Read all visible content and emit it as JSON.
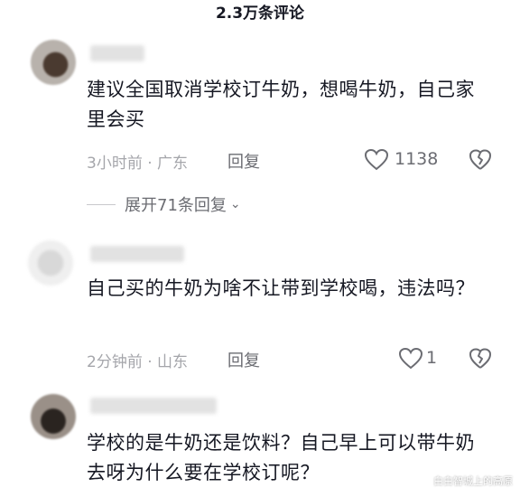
{
  "header": {
    "title": "2.3万条评论"
  },
  "comments": [
    {
      "text": "建议全国取消学校订牛奶，想喝牛奶，自己家里会买",
      "time_location": "3小时前 · 广东",
      "reply_label": "回复",
      "likes": "1138",
      "expand_label": "展开71条回复"
    },
    {
      "text": "自己买的牛奶为啥不让带到学校喝，违法吗？",
      "time_location": "2分钟前 · 山东",
      "reply_label": "回复",
      "likes": "1"
    },
    {
      "text": "学校的是牛奶还是饮料？自己早上可以带牛奶去呀为什么要在学校订呢？"
    }
  ],
  "watermark": "白白智城上的高原",
  "icons": {
    "like": "heart-outline-icon",
    "dislike": "broken-heart-icon",
    "expand": "chevron-down-icon"
  },
  "colors": {
    "text": "#161823",
    "meta": "#a5a6ab",
    "secondary": "#6b6c72"
  }
}
